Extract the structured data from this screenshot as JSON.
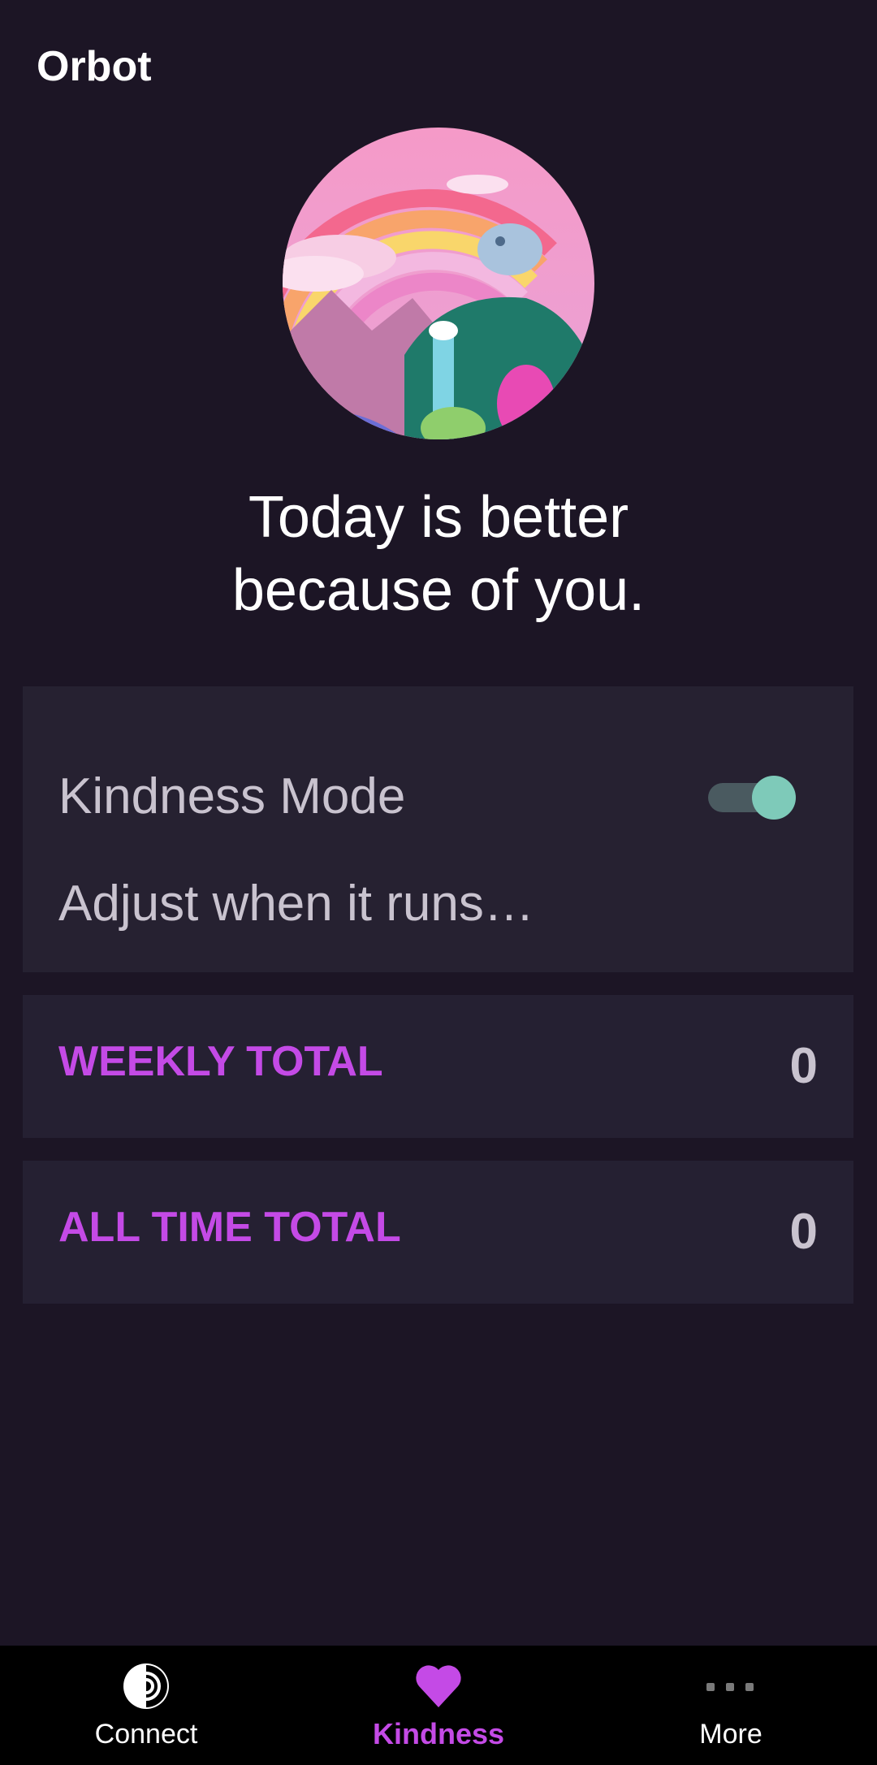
{
  "app": {
    "title": "Orbot"
  },
  "hero": {
    "tagline_line1": "Today is better",
    "tagline_line2": "because of you."
  },
  "kindness_mode": {
    "label": "Kindness Mode",
    "enabled": true,
    "adjust_label": "Adjust when it runs…"
  },
  "totals": {
    "weekly_label": "WEEKLY TOTAL",
    "weekly_value": "0",
    "alltime_label": "ALL TIME TOTAL",
    "alltime_value": "0"
  },
  "bottom_nav": {
    "items": [
      {
        "label": "Connect",
        "icon": "tor-onion-icon",
        "active": false
      },
      {
        "label": "Kindness",
        "icon": "heart-icon",
        "active": true
      },
      {
        "label": "More",
        "icon": "more-dots-icon",
        "active": false
      }
    ]
  },
  "colors": {
    "background": "#1c1525",
    "card": "#252032",
    "accent": "#c44ae6",
    "toggle_thumb": "#7ecab9"
  }
}
